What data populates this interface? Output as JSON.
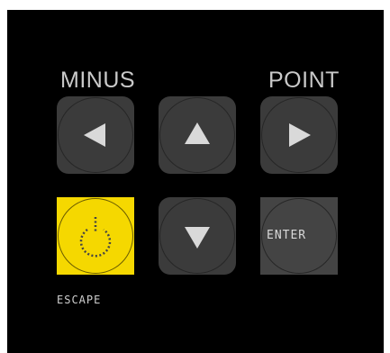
{
  "labels": {
    "minus": "MINUS",
    "point": "POINT"
  },
  "keys": {
    "left": {
      "icon": "arrow-left-icon"
    },
    "up": {
      "icon": "arrow-up-icon"
    },
    "right": {
      "icon": "arrow-right-icon"
    },
    "down": {
      "icon": "arrow-down-icon"
    },
    "escape": {
      "icon": "power-icon",
      "color": "#f5d800",
      "caption": "ESCAPE"
    },
    "enter": {
      "text": "ENTER"
    }
  },
  "colors": {
    "panel": "#000000",
    "key": "#3b3b3b",
    "escape": "#f5d800",
    "glyph": "#d9d9d9"
  }
}
